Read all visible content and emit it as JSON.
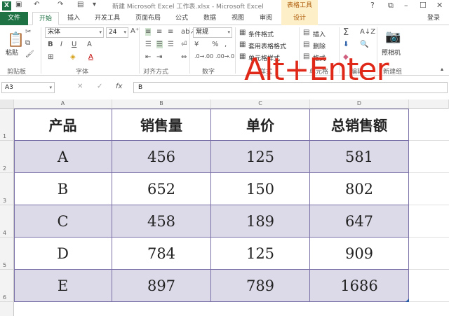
{
  "window": {
    "title": "新建 Microsoft Excel 工作表.xlsx - Microsoft Excel",
    "context_tools": "表格工具",
    "app_icon": "X",
    "controls": [
      "?",
      "⧉",
      "–",
      "☐",
      "✕"
    ]
  },
  "tabs": [
    "文件",
    "开始",
    "插入",
    "开发工具",
    "页面布局",
    "公式",
    "数据",
    "视图",
    "审阅",
    "设计"
  ],
  "account": "登录",
  "ribbon": {
    "paste_label": "粘贴",
    "font_name": "宋体",
    "font_size": "24",
    "number_format": "常规",
    "conditional_format": "条件格式",
    "format_as_table": "套用表格格式",
    "cell_styles": "单元格样式",
    "insert": "插入",
    "delete": "删除",
    "format": "格式",
    "camera": "照相机",
    "groups": [
      "剪贴板",
      "字体",
      "对齐方式",
      "数字",
      "样式",
      "单元格",
      "编辑",
      "新建组"
    ]
  },
  "overlay_text": "Alt+Enter",
  "formula_bar": {
    "name_box": "A3",
    "fx_label": "fx",
    "content": "B"
  },
  "columns": [
    "A",
    "B",
    "C",
    "D"
  ],
  "rows": [
    "1",
    "2",
    "3",
    "4",
    "5",
    "6"
  ],
  "table": {
    "headers": [
      "产品",
      "销售量",
      "单价",
      "总销售额"
    ],
    "rows": [
      [
        "A",
        "456",
        "125",
        "581"
      ],
      [
        "B",
        "652",
        "150",
        "802"
      ],
      [
        "C",
        "458",
        "189",
        "647"
      ],
      [
        "D",
        "784",
        "125",
        "909"
      ],
      [
        "E",
        "897",
        "789",
        "1686"
      ]
    ]
  },
  "colors": {
    "brand_green": "#1f7244",
    "band": "#dcdae8",
    "border": "#7a6fa6",
    "overlay": "#e02818"
  }
}
